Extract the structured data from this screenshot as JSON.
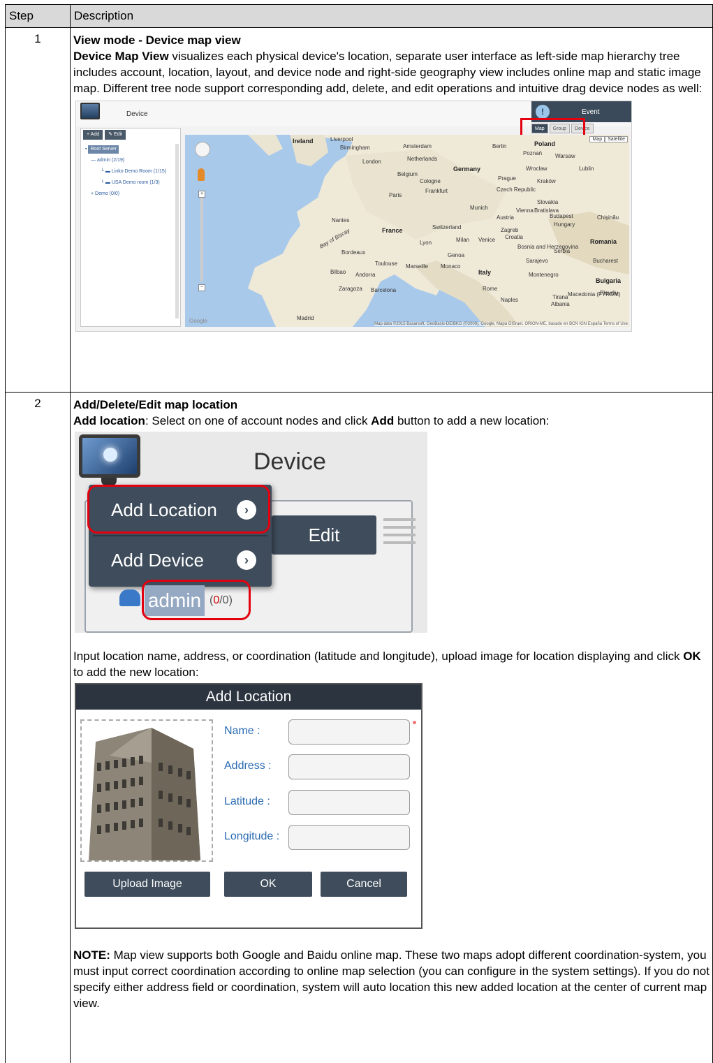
{
  "table": {
    "header": {
      "step": "Step",
      "description": "Description"
    },
    "row1": {
      "step": "1",
      "heading": "View mode - Device map view",
      "lead_bold": "Device Map View",
      "lead_text": " visualizes each physical device's location, separate user interface as left-side map hierarchy tree includes account, location, layout, and device node and right-side geography view includes online map and static image map. Different tree node support corresponding add, delete, and edit operations and intuitive drag device nodes as well:"
    },
    "row2": {
      "step": "2",
      "heading": "Add/Delete/Edit map location",
      "para1_bold": "Add location",
      "para1_text_a": ": Select on one of account nodes and click ",
      "para1_bold2": "Add",
      "para1_text_b": " button to add a new location:",
      "para2_text_a": "Input location name, address, or coordination (latitude and longitude), upload image for location displaying and click ",
      "para2_bold": "OK",
      "para2_text_b": " to add the new location:",
      "note_bold": "NOTE:",
      "note_text": " Map view supports both Google and Baidu online map. These two maps adopt different coordination-system, you must input correct coordination according to online map selection (you can configure in the system settings). If you do not specify either address field or coordination, system will auto location this new added location at the center of current map view."
    }
  },
  "screenshot1": {
    "title": "Device",
    "event_label": "Event",
    "tabs": [
      "Map",
      "Group",
      "Device"
    ],
    "toolbar": {
      "add": "Add",
      "edit": "Edit"
    },
    "tree": {
      "root": "Root Server",
      "admin": "admin (2/19)",
      "loc1": "Linko Demo Room (1/15)",
      "loc2": "USA Demo room (1/3)",
      "demo": "Demo (0/0)"
    },
    "map_type": [
      "Map",
      "Satellite"
    ],
    "map_labels": [
      "Ireland",
      "Liverpool",
      "Birmingham",
      "London",
      "Amsterdam",
      "Netherlands",
      "Belgium",
      "Germany",
      "Berlin",
      "Poland",
      "Warsaw",
      "Czech Republic",
      "Prague",
      "Paris",
      "France",
      "Switzerland",
      "Austria",
      "Munich",
      "Slovakia",
      "Hungary",
      "Budapest",
      "Romania",
      "Croatia",
      "Serbia",
      "Bosnia and Herzegovina",
      "Italy",
      "Rome",
      "Milan",
      "Venice",
      "Bulgaria",
      "Toulouse",
      "Barcelona",
      "Madrid",
      "Zaragoza",
      "Naples",
      "Bay of Biscay",
      "Marseille",
      "Monaco",
      "Lyon",
      "Nantes",
      "Bordeaux",
      "Bilbao",
      "Andorra",
      "Frankfurt",
      "Cologne",
      "Kraków",
      "Lublin",
      "Wroclaw",
      "Poznań",
      "Bucharest",
      "Sarajevo",
      "Montenegro",
      "Albania",
      "Tirana",
      "Macedonia (FYROM)",
      "Plovdiv",
      "Bratislava",
      "Vienna",
      "Zagreb",
      "Genoa",
      "Chișinău"
    ],
    "attribution": "Map data ©2015 Basarsoft, GeoBasis-DE/BKG (©2009), Google, Mapa GISrael, ORION-ME, basado en BCN IGN España  Terms of Use",
    "google": "Google"
  },
  "screenshot2": {
    "title": "Device",
    "menu": [
      "Add Location",
      "Add Device"
    ],
    "edit": "Edit",
    "admin": "admin",
    "count_open": "(",
    "count_red": "0",
    "count_rest": "/0)"
  },
  "screenshot3": {
    "title": "Add Location",
    "fields": [
      "Name :",
      "Address :",
      "Latitude :",
      "Longitude :"
    ],
    "buttons": {
      "upload": "Upload Image",
      "ok": "OK",
      "cancel": "Cancel"
    }
  },
  "colors": {
    "header_bg": "#d9d9d9",
    "highlight_red": "#e3000f",
    "dark_ui": "#3e4c5b"
  }
}
